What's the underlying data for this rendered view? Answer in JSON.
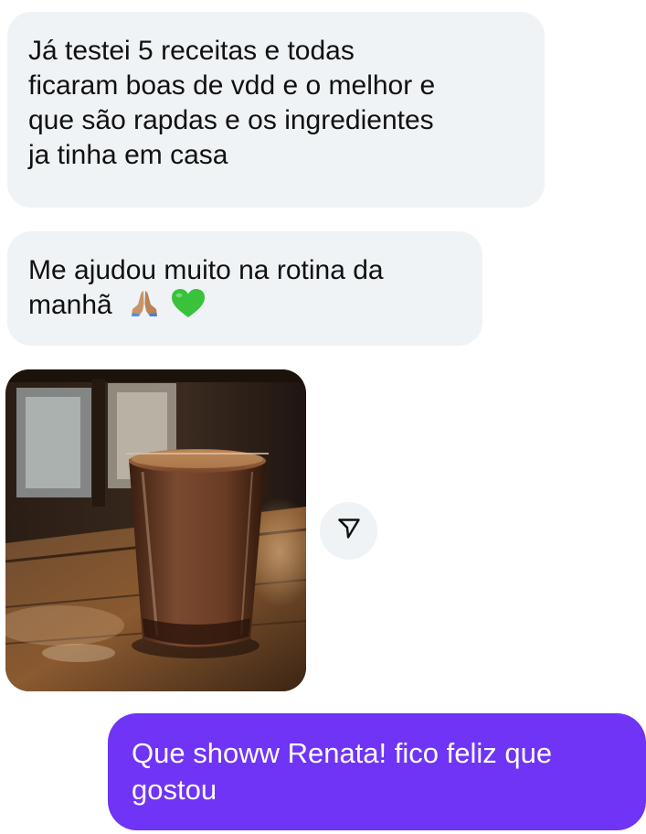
{
  "messages": [
    {
      "from": "other",
      "lines": [
        "Já testei 5 receitas e todas",
        "ficaram boas de vdd e o melhor e",
        "que são rapdas e os ingredientes",
        "ja tinha em casa"
      ]
    },
    {
      "from": "other",
      "lines": [
        "Me ajudou muito na rotina da",
        "manhã"
      ],
      "emojis": [
        "folded-hands-emoji",
        "green-heart-emoji"
      ]
    },
    {
      "from": "other",
      "type": "image",
      "image": "photo of a glass of iced coffee on a wooden table"
    },
    {
      "from": "me",
      "lines": [
        "Que showw Renata! fico feliz que",
        "gostou"
      ]
    }
  ],
  "share_button": {
    "icon": "send-icon"
  },
  "colors": {
    "incoming_bubble": "#eff3f5",
    "outgoing_bubble": "#6f34f5",
    "outgoing_text": "#ffffff",
    "incoming_text": "#111111"
  }
}
